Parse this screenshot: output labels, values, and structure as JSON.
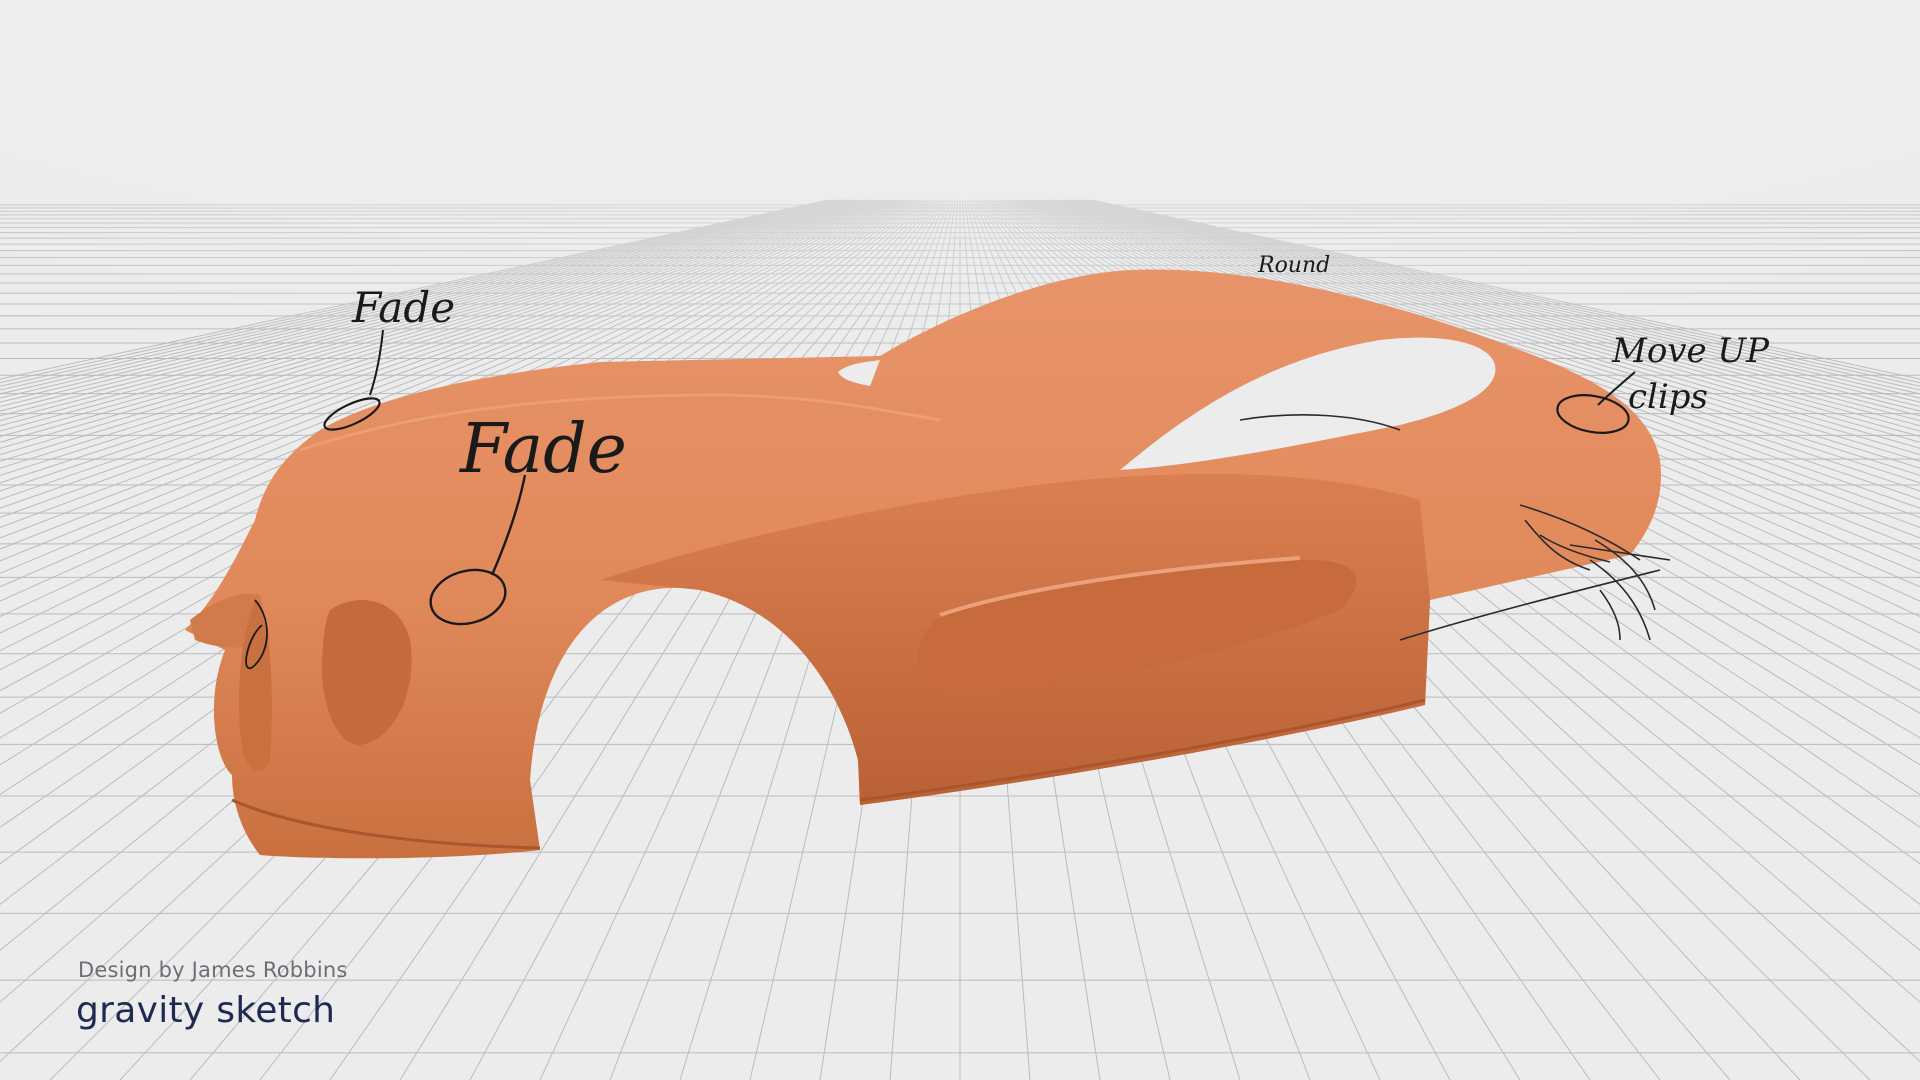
{
  "canvas": {
    "background": "#ececec",
    "grid_color": "#b9bbbe",
    "body_color": "#e0895a",
    "body_shadow": "#b95f35",
    "ink_color": "#1a1a1a"
  },
  "annotations": {
    "fade_small": "Fade",
    "fade_large": "Fade",
    "roof_note": "Round",
    "move_up": "Move UP",
    "clips": "clips"
  },
  "footer": {
    "credit": "Design by James Robbins",
    "brand": "gravity sketch"
  }
}
